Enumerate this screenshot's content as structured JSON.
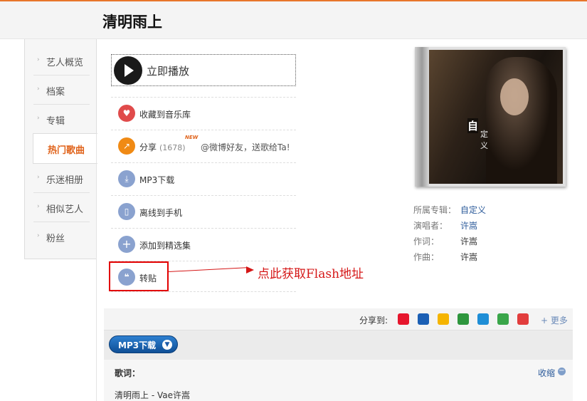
{
  "page": {
    "title": "清明雨上"
  },
  "sidebar": {
    "items": [
      {
        "label": "艺人概览",
        "active": false
      },
      {
        "label": "档案",
        "active": false
      },
      {
        "label": "专辑",
        "active": false
      },
      {
        "label": "热门歌曲",
        "active": true
      },
      {
        "label": "乐迷相册",
        "active": false
      },
      {
        "label": "相似艺人",
        "active": false
      },
      {
        "label": "粉丝",
        "active": false
      }
    ]
  },
  "actions": {
    "play_label": "立即播放",
    "collect_label": "收藏到音乐库",
    "share_label": "分享",
    "share_count": "(1678)",
    "new_badge": "NEW",
    "share_extra": "@微博好友，送歌给Ta!",
    "mp3_label": "MP3下载",
    "offline_label": "离线到手机",
    "add_label": "添加到精选集",
    "repost_label": "转贴"
  },
  "annotation": {
    "text": "点此获取Flash地址",
    "color": "#d51717"
  },
  "album_cover": {
    "title_big": "自",
    "title_small1": "定",
    "title_small2": "义"
  },
  "meta": {
    "album_key": "所属专辑：",
    "album_value": "自定义",
    "singer_key": "演唱者：",
    "singer_value": "许嵩",
    "lyricist_key": "作词：",
    "lyricist_value": "许嵩",
    "composer_key": "作曲：",
    "composer_value": "许嵩"
  },
  "share_bar": {
    "label": "分享到:",
    "more": "+ 更多",
    "icons": [
      {
        "name": "weibo-icon",
        "color": "#e6162d"
      },
      {
        "name": "renren-icon",
        "color": "#1b5fb4"
      },
      {
        "name": "qzone-icon",
        "color": "#f5b400"
      },
      {
        "name": "douban-icon",
        "color": "#2e963d"
      },
      {
        "name": "kaixin-icon",
        "color": "#1f8ed6"
      },
      {
        "name": "feixin-icon",
        "color": "#3aa64a"
      },
      {
        "name": "tqq-icon",
        "color": "#e23d3d"
      }
    ]
  },
  "download_bar": {
    "button_label": "MP3下载"
  },
  "lyrics": {
    "label": "歌词：",
    "collapse": "收缩",
    "first_line": "清明雨上 - Vae许嵩"
  },
  "colors": {
    "accent": "#e0631b",
    "link": "#2b5a9a"
  }
}
